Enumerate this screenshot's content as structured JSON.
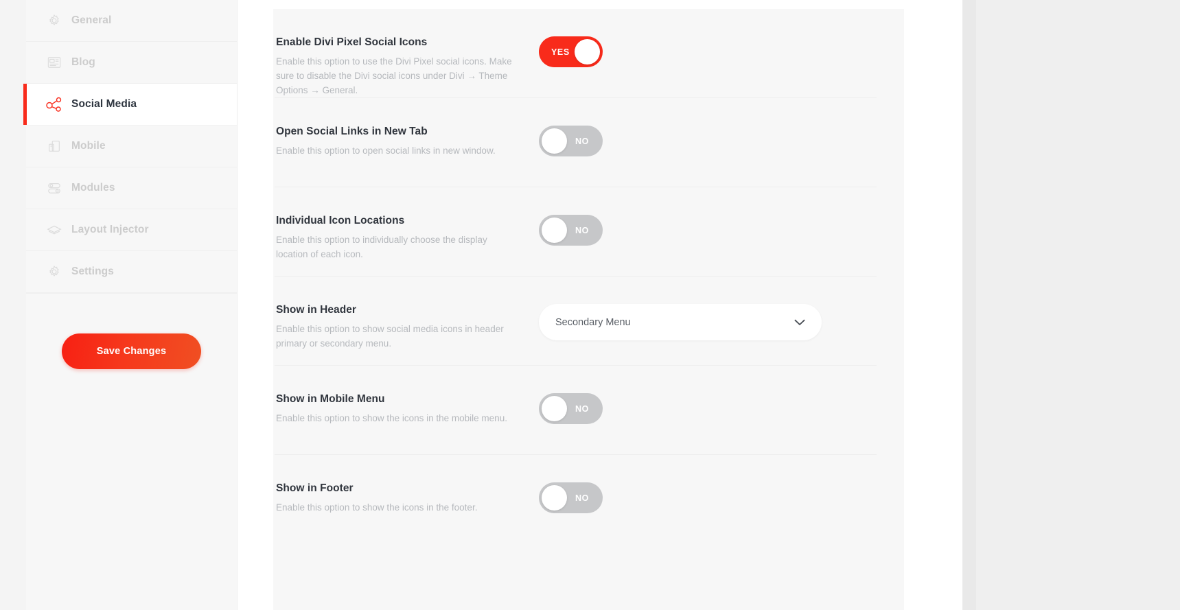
{
  "sidebar": {
    "items": [
      {
        "label": "General",
        "icon": "gear-icon",
        "active": false
      },
      {
        "label": "Blog",
        "icon": "blog-icon",
        "active": false
      },
      {
        "label": "Social Media",
        "icon": "share-icon",
        "active": true
      },
      {
        "label": "Mobile",
        "icon": "mobile-icon",
        "active": false
      },
      {
        "label": "Modules",
        "icon": "modules-icon",
        "active": false
      },
      {
        "label": "Layout Injector",
        "icon": "layers-icon",
        "active": false
      },
      {
        "label": "Settings",
        "icon": "gear-icon",
        "active": false
      }
    ],
    "save_button": "Save Changes"
  },
  "colors": {
    "accent_red": "#f82b1b",
    "toggle_off_gray": "#c6c7c9",
    "panel_bg": "#f7f7f7",
    "title_text": "#30353d",
    "desc_text": "#b6b9bd"
  },
  "options": [
    {
      "title": "Enable Divi Pixel Social Icons",
      "description": "Enable this option to use the Divi Pixel social icons. Make sure to disable the Divi social icons under Divi → Theme Options → General.",
      "control": "toggle",
      "value": "YES",
      "state": "on"
    },
    {
      "title": "Open Social Links in New Tab",
      "description": "Enable this option to open social links in new window.",
      "control": "toggle",
      "value": "NO",
      "state": "off"
    },
    {
      "title": "Individual Icon Locations",
      "description": "Enable this option to individually choose the display location of each icon.",
      "control": "toggle",
      "value": "NO",
      "state": "off"
    },
    {
      "title": "Show in Header",
      "description": "Enable this option to show social media icons in header primary or secondary menu.",
      "control": "select",
      "value": "Secondary Menu",
      "state": "off"
    },
    {
      "title": "Show in Mobile Menu",
      "description": "Enable this option to show the icons in the mobile menu.",
      "control": "toggle",
      "value": "NO",
      "state": "off"
    },
    {
      "title": "Show in Footer",
      "description": "Enable this option to show the icons in the footer.",
      "control": "toggle",
      "value": "NO",
      "state": "off"
    }
  ]
}
